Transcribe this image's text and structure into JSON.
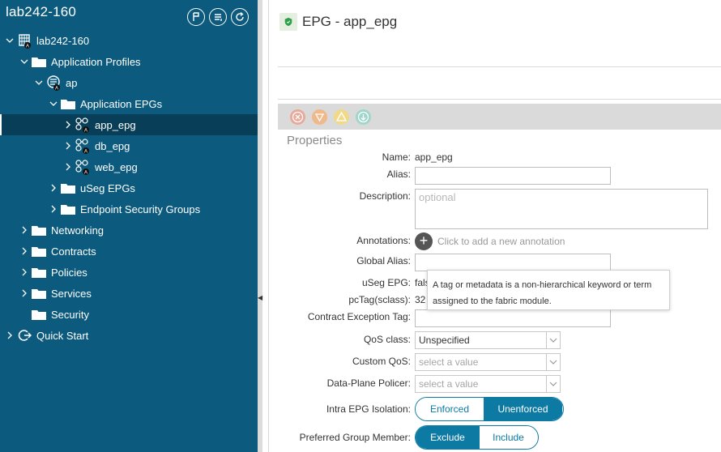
{
  "sidebar": {
    "title": "lab242-160",
    "header_buttons": [
      "tag-icon",
      "list-icon",
      "refresh-icon"
    ],
    "tree": [
      {
        "label": "lab242-160",
        "icon": "tenant-icon",
        "badge": "A",
        "expanded": true
      },
      {
        "label": "Application Profiles",
        "icon": "folder-icon",
        "expanded": true
      },
      {
        "label": "ap",
        "icon": "app-profile-icon",
        "badge": "A",
        "expanded": true
      },
      {
        "label": "Application EPGs",
        "icon": "folder-icon",
        "expanded": true
      },
      {
        "label": "app_epg",
        "icon": "epg-icon",
        "badge": "A",
        "selected": true
      },
      {
        "label": "db_epg",
        "icon": "epg-icon",
        "badge": "A"
      },
      {
        "label": "web_epg",
        "icon": "epg-icon",
        "badge": "A"
      },
      {
        "label": "uSeg EPGs",
        "icon": "folder-icon"
      },
      {
        "label": "Endpoint Security Groups",
        "icon": "folder-icon"
      },
      {
        "label": "Networking",
        "icon": "folder-icon"
      },
      {
        "label": "Contracts",
        "icon": "folder-icon"
      },
      {
        "label": "Policies",
        "icon": "folder-icon"
      },
      {
        "label": "Services",
        "icon": "folder-icon"
      },
      {
        "label": "Security",
        "icon": "folder-icon"
      },
      {
        "label": "Quick Start",
        "icon": "quick-start-icon"
      }
    ]
  },
  "header": {
    "title": "EPG - app_epg",
    "icon": "shield-icon"
  },
  "fault_icons": [
    {
      "name": "critical-fault-icon",
      "color": "#e8a99a"
    },
    {
      "name": "major-fault-icon",
      "color": "#f0b98a"
    },
    {
      "name": "minor-fault-icon",
      "color": "#f1d98a"
    },
    {
      "name": "warning-fault-icon",
      "color": "#9fd6cc"
    }
  ],
  "properties": {
    "heading": "Properties",
    "name_label": "Name:",
    "name_value": "app_epg",
    "alias_label": "Alias:",
    "alias_value": "",
    "description_label": "Description:",
    "description_placeholder": "optional",
    "annotations_label": "Annotations:",
    "annotations_hint": "Click to add a new annotation",
    "global_alias_label": "Global Alias:",
    "global_alias_value": "",
    "useg_label": "uSeg EPG:",
    "useg_value": "fals",
    "pctag_label": "pcTag(sclass):",
    "pctag_value": "32",
    "contract_exception_label": "Contract Exception Tag:",
    "contract_exception_value": "",
    "qos_label": "QoS class:",
    "qos_value": "Unspecified",
    "custom_qos_label": "Custom QoS:",
    "custom_qos_placeholder": "select a value",
    "policer_label": "Data-Plane Policer:",
    "policer_placeholder": "select a value",
    "isolation_label": "Intra EPG Isolation:",
    "isolation_options": [
      "Enforced",
      "Unenforced"
    ],
    "isolation_selected": "Unenforced",
    "preferred_label": "Preferred Group Member:",
    "preferred_options": [
      "Exclude",
      "Include"
    ],
    "preferred_selected": "Exclude"
  },
  "tooltip": {
    "line1": "A tag or metadata is a non-hierarchical keyword or term",
    "line2": "assigned to the fabric module."
  },
  "colors": {
    "sidebar_bg": "#0c5a7d",
    "sidebar_selected": "#083e57",
    "accent": "#0d7aa3"
  }
}
